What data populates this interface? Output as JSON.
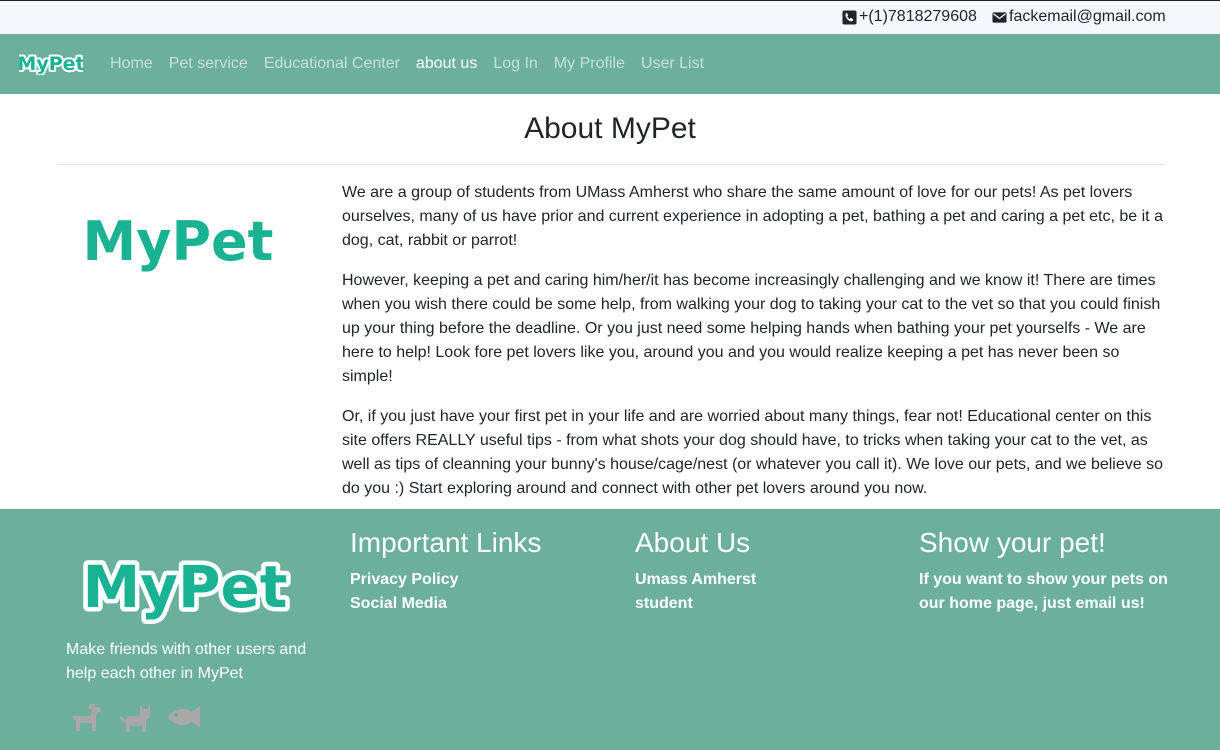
{
  "contact": {
    "phone": "+(1)7818279608",
    "email": "fackemail@gmail.com"
  },
  "brand": {
    "logo_text": "MyPet"
  },
  "nav": {
    "items": [
      {
        "label": "Home",
        "active": false
      },
      {
        "label": "Pet service",
        "active": false
      },
      {
        "label": "Educational Center",
        "active": false
      },
      {
        "label": "about us",
        "active": true
      },
      {
        "label": "Log In",
        "active": false
      },
      {
        "label": "My Profile",
        "active": false
      },
      {
        "label": "User List",
        "active": false
      }
    ]
  },
  "main": {
    "title": "About MyPet",
    "logo_text": "MyPet",
    "paragraphs": [
      "We are a group of students from UMass Amherst who share the same amount of love for our pets! As pet lovers ourselves, many of us have prior and current experience in adopting a pet, bathing a pet and caring a pet etc, be it a dog, cat, rabbit or parrot!",
      "However, keeping a pet and caring him/her/it has become increasingly challenging and we know it! There are times when you wish there could be some help, from walking your dog to taking your cat to the vet so that you could finish up your thing before the deadline. Or you just need some helping hands when bathing your pet yourselfs - We are here to help! Look fore pet lovers like you, around you and you would realize keeping a pet has never been so simple!",
      "Or, if you just have your first pet in your life and are worried about many things, fear not! Educational center on this site offers REALLY useful tips - from what shots your dog should have, to tricks when taking your cat to the vet, as well as tips of cleanning your bunny's house/cage/nest (or whatever you call it). We love our pets, and we believe so do you :) Start exploring around and connect with other pet lovers around you now."
    ]
  },
  "footer": {
    "logo_text": "MyPet",
    "tagline": "Make friends with other users and help each other in MyPet",
    "pet_icons": [
      "dog-icon",
      "cat-icon",
      "fish-icon"
    ],
    "important_links": {
      "title": "Important Links",
      "links": [
        "Privacy Policy",
        "Social Media"
      ]
    },
    "about": {
      "title": "About Us",
      "text": "Umass Amherst student"
    },
    "show_pet": {
      "title": "Show your pet!",
      "text": "If you want to show your pets on our home page, just email us!"
    }
  },
  "colors": {
    "brand_green": "#6caf9c",
    "logo_teal": "#19b394",
    "topbar_bg": "#f6f6fd"
  }
}
